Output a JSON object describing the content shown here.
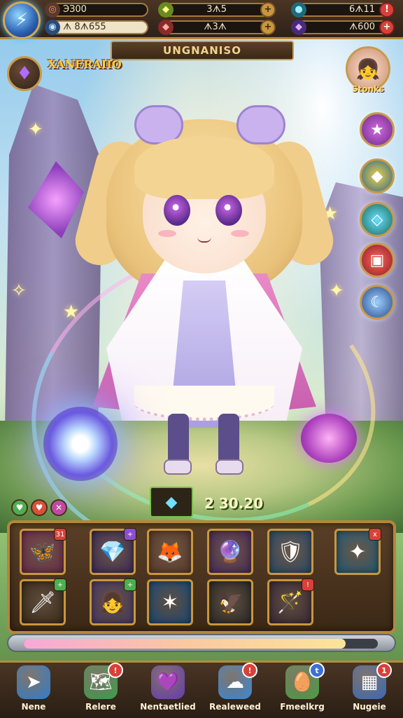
{
  "resources": {
    "top_left_value": "ЭЗ00",
    "bottom_left_value": "ᗑ 8ᗑ655",
    "top_mid_value": "3ᗑ5",
    "bottom_mid_value": "ᗑ3ᗑ",
    "top_right_value": "6ᗑ11",
    "bottom_right_value": "ᗑ600",
    "plus": "+",
    "exclaim": "!"
  },
  "title_banner": "UNGNANISO",
  "hero_name": "XANERAIIO",
  "avatar_label": "Stonks",
  "score_value": "2 30.20",
  "inventory_slots": [
    {
      "icon": "winged-helm-icon",
      "glyph": "🦋",
      "badge": "31",
      "badge_color": "#d8413a",
      "bg": "#6b2a4a"
    },
    {
      "icon": "blue-crystal-icon",
      "glyph": "💎",
      "badge": "+",
      "badge_color": "#8b4fd0",
      "bg": "#3a2a5a"
    },
    {
      "icon": "fox-girl-portrait-icon",
      "glyph": "🦊",
      "badge": "",
      "badge_color": "",
      "bg": "#5a3a2a"
    },
    {
      "icon": "magic-scroll-icon",
      "glyph": "🔮",
      "badge": "",
      "badge_color": "",
      "bg": "#4a2a5a"
    },
    {
      "icon": "silver-gauntlet-icon",
      "glyph": "🛡",
      "badge": "",
      "badge_color": "",
      "bg": "#2a4a6a"
    },
    {
      "icon": "gold-shard-icon",
      "glyph": "✦",
      "badge": "x",
      "badge_color": "#d8413a",
      "bg": "#1f5a7a"
    },
    {
      "icon": "fire-sword-icon",
      "glyph": "🗡",
      "badge": "+",
      "badge_color": "#4caf50",
      "bg": "#3a2a1a"
    },
    {
      "icon": "anime-girl-portrait-icon",
      "glyph": "👧",
      "badge": "+",
      "badge_color": "#4caf50",
      "bg": "#4a3a6a"
    },
    {
      "icon": "star-burst-icon",
      "glyph": "✶",
      "badge": "",
      "badge_color": "",
      "bg": "#1a4a7a"
    },
    {
      "icon": "eagle-emblem-icon",
      "glyph": "🦅",
      "badge": "",
      "badge_color": "",
      "bg": "#2a2a2a"
    },
    {
      "icon": "golden-staff-icon",
      "glyph": "🪄",
      "badge": "!",
      "badge_color": "#d8413a",
      "bg": "#3a2a3a"
    }
  ],
  "progress": 0.91,
  "bottom_nav": [
    {
      "label": "Nene",
      "icon": "home-arrow-icon",
      "glyph": "➤",
      "bg": "#2f7fd0",
      "noti": ""
    },
    {
      "label": "Relere",
      "icon": "map-scroll-icon",
      "glyph": "🗺",
      "bg": "#3aa04a",
      "noti": "!"
    },
    {
      "label": "Nentaetlied",
      "icon": "purple-crystal-icon",
      "glyph": "💜",
      "bg": "#6a3ab0",
      "noti": ""
    },
    {
      "label": "Realeweed",
      "icon": "blue-cloud-icon",
      "glyph": "☁",
      "bg": "#3a8ad8",
      "noti": "!"
    },
    {
      "label": "Fmeelkrg",
      "icon": "green-egg-icon",
      "glyph": "🥚",
      "bg": "#4aa040",
      "noti": "t"
    },
    {
      "label": "Nugeie",
      "icon": "menu-grid-icon",
      "glyph": "▦",
      "bg": "#3a6ab8",
      "noti": "1"
    }
  ],
  "colors": {
    "frame_gold": "#b88a3e",
    "panel_brown": "#4a3524",
    "accent_red": "#d8413a"
  }
}
